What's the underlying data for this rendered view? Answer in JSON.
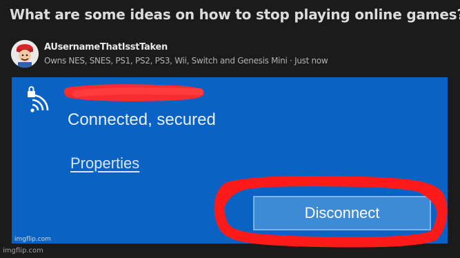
{
  "post": {
    "question": "What are some ideas on how to stop playing online games?",
    "author": "AUsernameThatIsstTaken",
    "credential": "Owns NES, SNES, PS1, PS2, PS3, Wii, Switch and Genesis Mini · Just now"
  },
  "network_panel": {
    "network_name": "",
    "status": "Connected, secured",
    "properties_link": "Properties",
    "disconnect_button": "Disconnect",
    "background_color": "#0a63c4",
    "button_color": "#3d8ad6"
  },
  "annotations": {
    "scribble_color": "#ff1a1a"
  },
  "watermarks": {
    "inner": "imgflip.com",
    "outer": "imgflip.com"
  },
  "icons": [
    "avatar-icon",
    "lock-icon",
    "wifi-icon"
  ]
}
